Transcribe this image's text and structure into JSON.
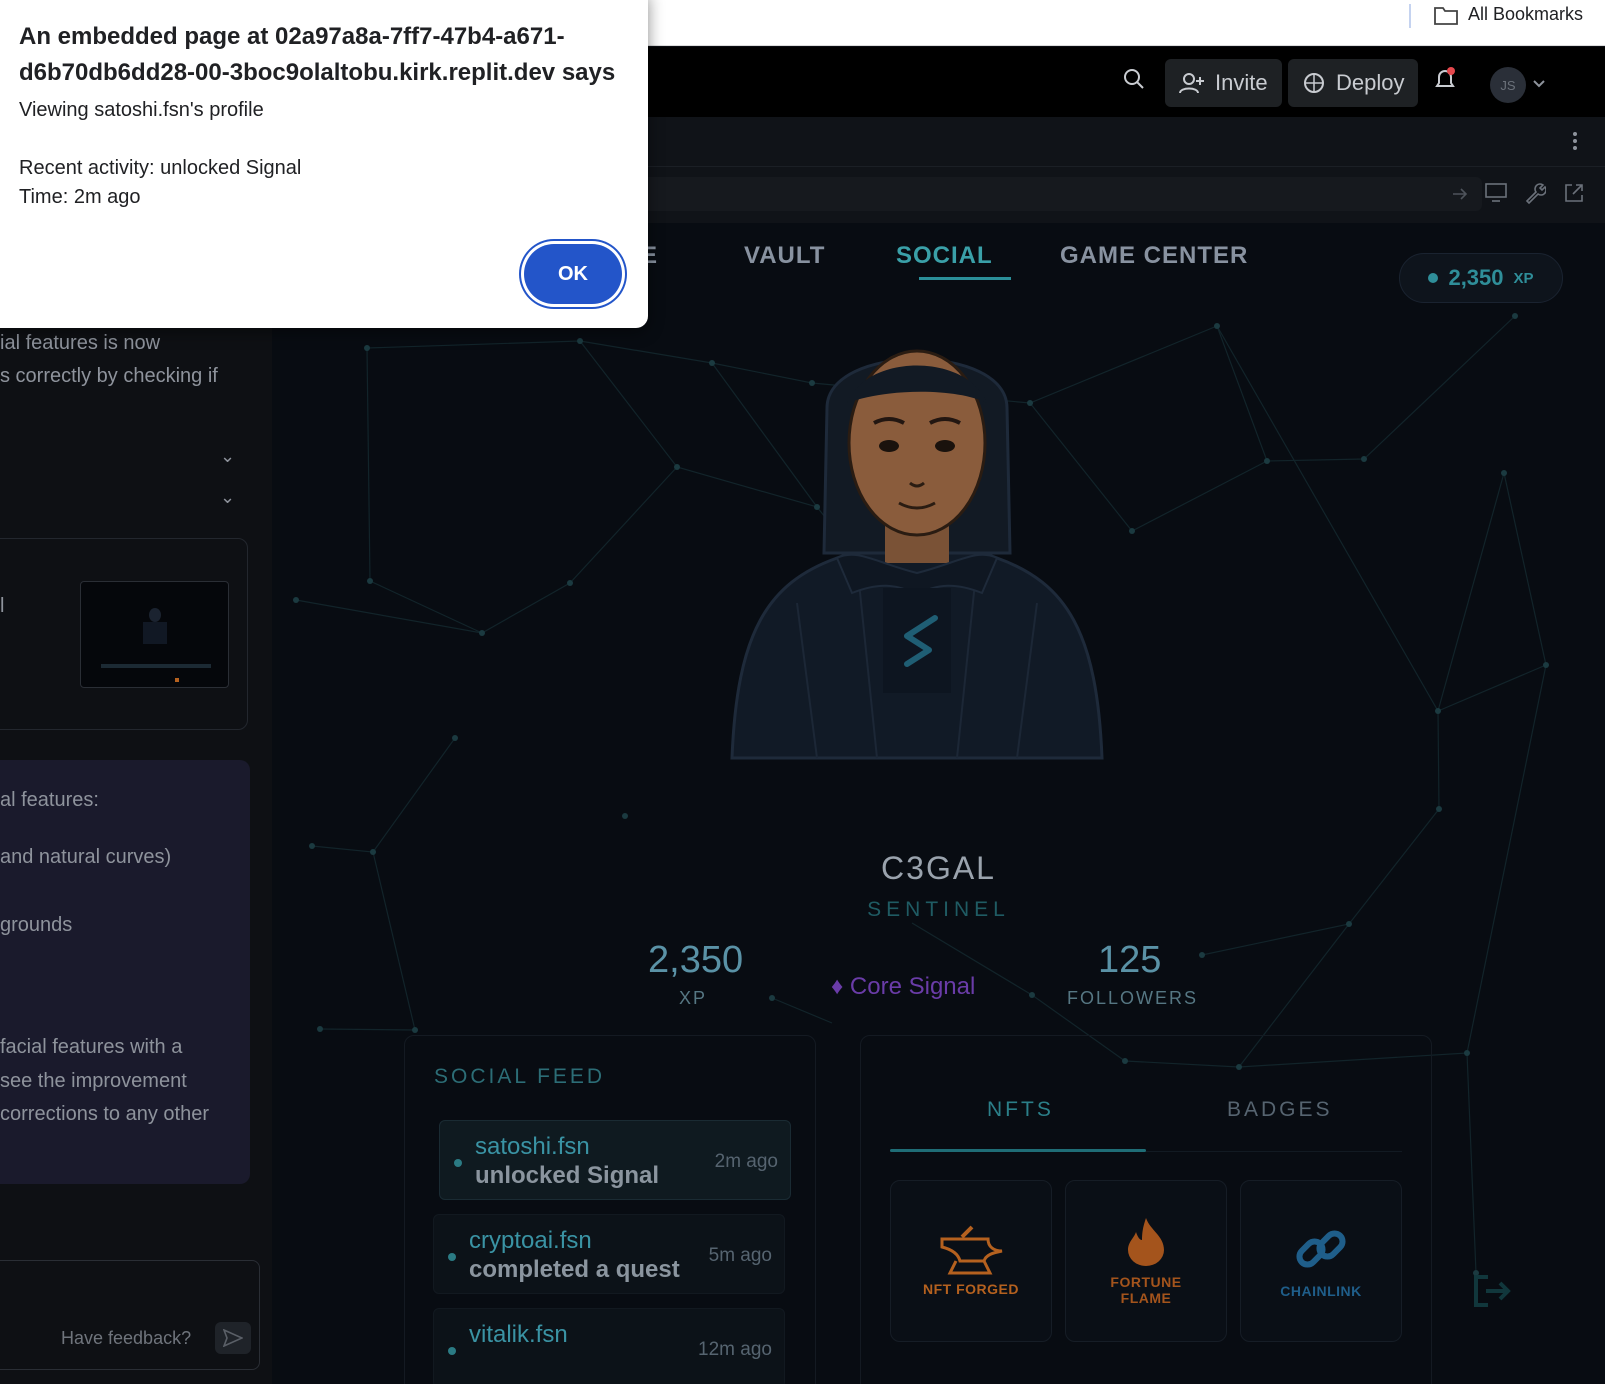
{
  "bookmarks": {
    "all_label": "All Bookmarks"
  },
  "topbar": {
    "invite_label": "Invite",
    "deploy_label": "Deploy",
    "avatar_initials": "JS"
  },
  "left_panel": {
    "lines_top": [
      "ial features is now",
      "s correctly by checking if"
    ],
    "card_line": "l",
    "purple_lines": [
      "al features:",
      "and natural curves)",
      "grounds",
      "facial features with a",
      "see the improvement",
      "corrections to any other"
    ],
    "feedback_placeholder": "Have feedback?"
  },
  "alert": {
    "title": "An embedded page at 02a97a8a-7ff7-47b4-a671-d6b70db6dd28-00-3boc9olaltobu.kirk.replit.dev says",
    "line1": "Viewing satoshi.fsn's profile",
    "line2": "Recent activity: unlocked Signal",
    "line3": "Time: 2m ago",
    "ok_label": "OK"
  },
  "app": {
    "nav": [
      "ME",
      "VAULT",
      "SOCIAL",
      "GAME CENTER"
    ],
    "active_nav": "SOCIAL",
    "xp_pill": {
      "value": "2,350",
      "unit": "XP"
    },
    "profile": {
      "name": "C3GAL",
      "role": "SENTINEL"
    },
    "stats": {
      "xp_value": "2,350",
      "xp_label": "XP",
      "tier": "Core Signal",
      "followers_value": "125",
      "followers_label": "FOLLOWERS"
    },
    "feed": {
      "title": "SOCIAL FEED",
      "items": [
        {
          "user": "satoshi.fsn",
          "action": "unlocked Signal",
          "time": "2m ago"
        },
        {
          "user": "cryptoai.fsn",
          "action": "completed a quest",
          "time": "5m ago"
        },
        {
          "user": "vitalik.fsn",
          "action": "",
          "time": "12m ago"
        }
      ]
    },
    "collection": {
      "tabs": [
        "NFTS",
        "BADGES"
      ],
      "active_tab": "NFTS",
      "cards": [
        {
          "label": "NFT FORGED",
          "icon": "anvil-icon",
          "color": "#b5611f"
        },
        {
          "label": "FORTUNE FLAME",
          "icon": "flame-icon",
          "color": "#a4541c"
        },
        {
          "label": "CHAINLINK",
          "icon": "chain-link-icon",
          "color": "#1f5e8a"
        }
      ]
    }
  }
}
